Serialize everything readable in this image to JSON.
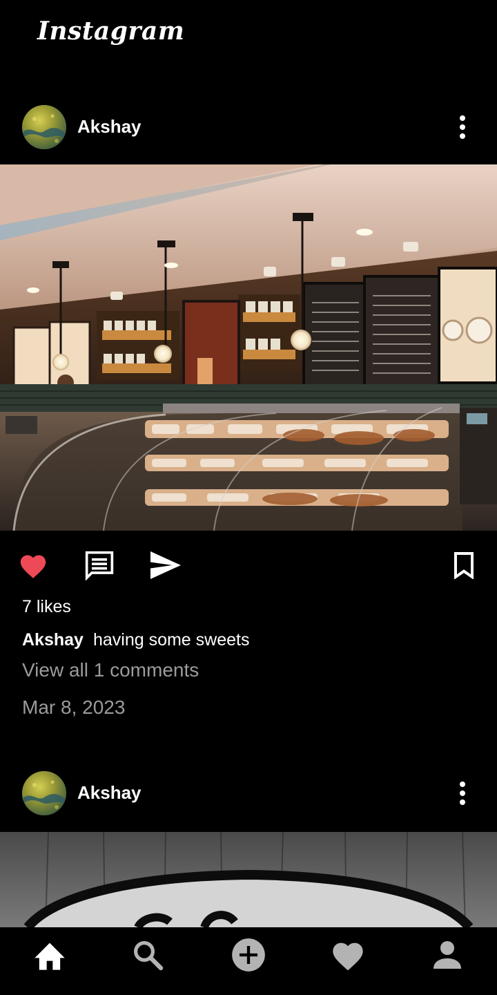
{
  "app": {
    "logo": "Instagram"
  },
  "posts": [
    {
      "username": "Akshay",
      "likes": "7 likes",
      "caption_user": "Akshay",
      "caption_text": "having some sweets",
      "view_comments": "View all 1 comments",
      "date": "Mar 8, 2023",
      "liked": true,
      "image": "cafe-counter-photo"
    },
    {
      "username": "Akshay",
      "image": "graffiti-wall-photo"
    }
  ],
  "icons": {
    "like": "heart-icon",
    "comment": "comment-icon",
    "share": "send-icon",
    "save": "bookmark-icon",
    "more": "more-vertical-icon"
  },
  "bottom_nav": [
    {
      "name": "home",
      "icon": "home-icon",
      "active": true
    },
    {
      "name": "search",
      "icon": "search-icon",
      "active": false
    },
    {
      "name": "add",
      "icon": "add-circle-icon",
      "active": false
    },
    {
      "name": "activity",
      "icon": "heart-icon",
      "active": false
    },
    {
      "name": "profile",
      "icon": "person-icon",
      "active": false
    }
  ],
  "colors": {
    "background": "#000000",
    "liked_heart": "#ed4956",
    "muted_text": "#9b9b9b",
    "nav_inactive": "#b3b3b3"
  }
}
